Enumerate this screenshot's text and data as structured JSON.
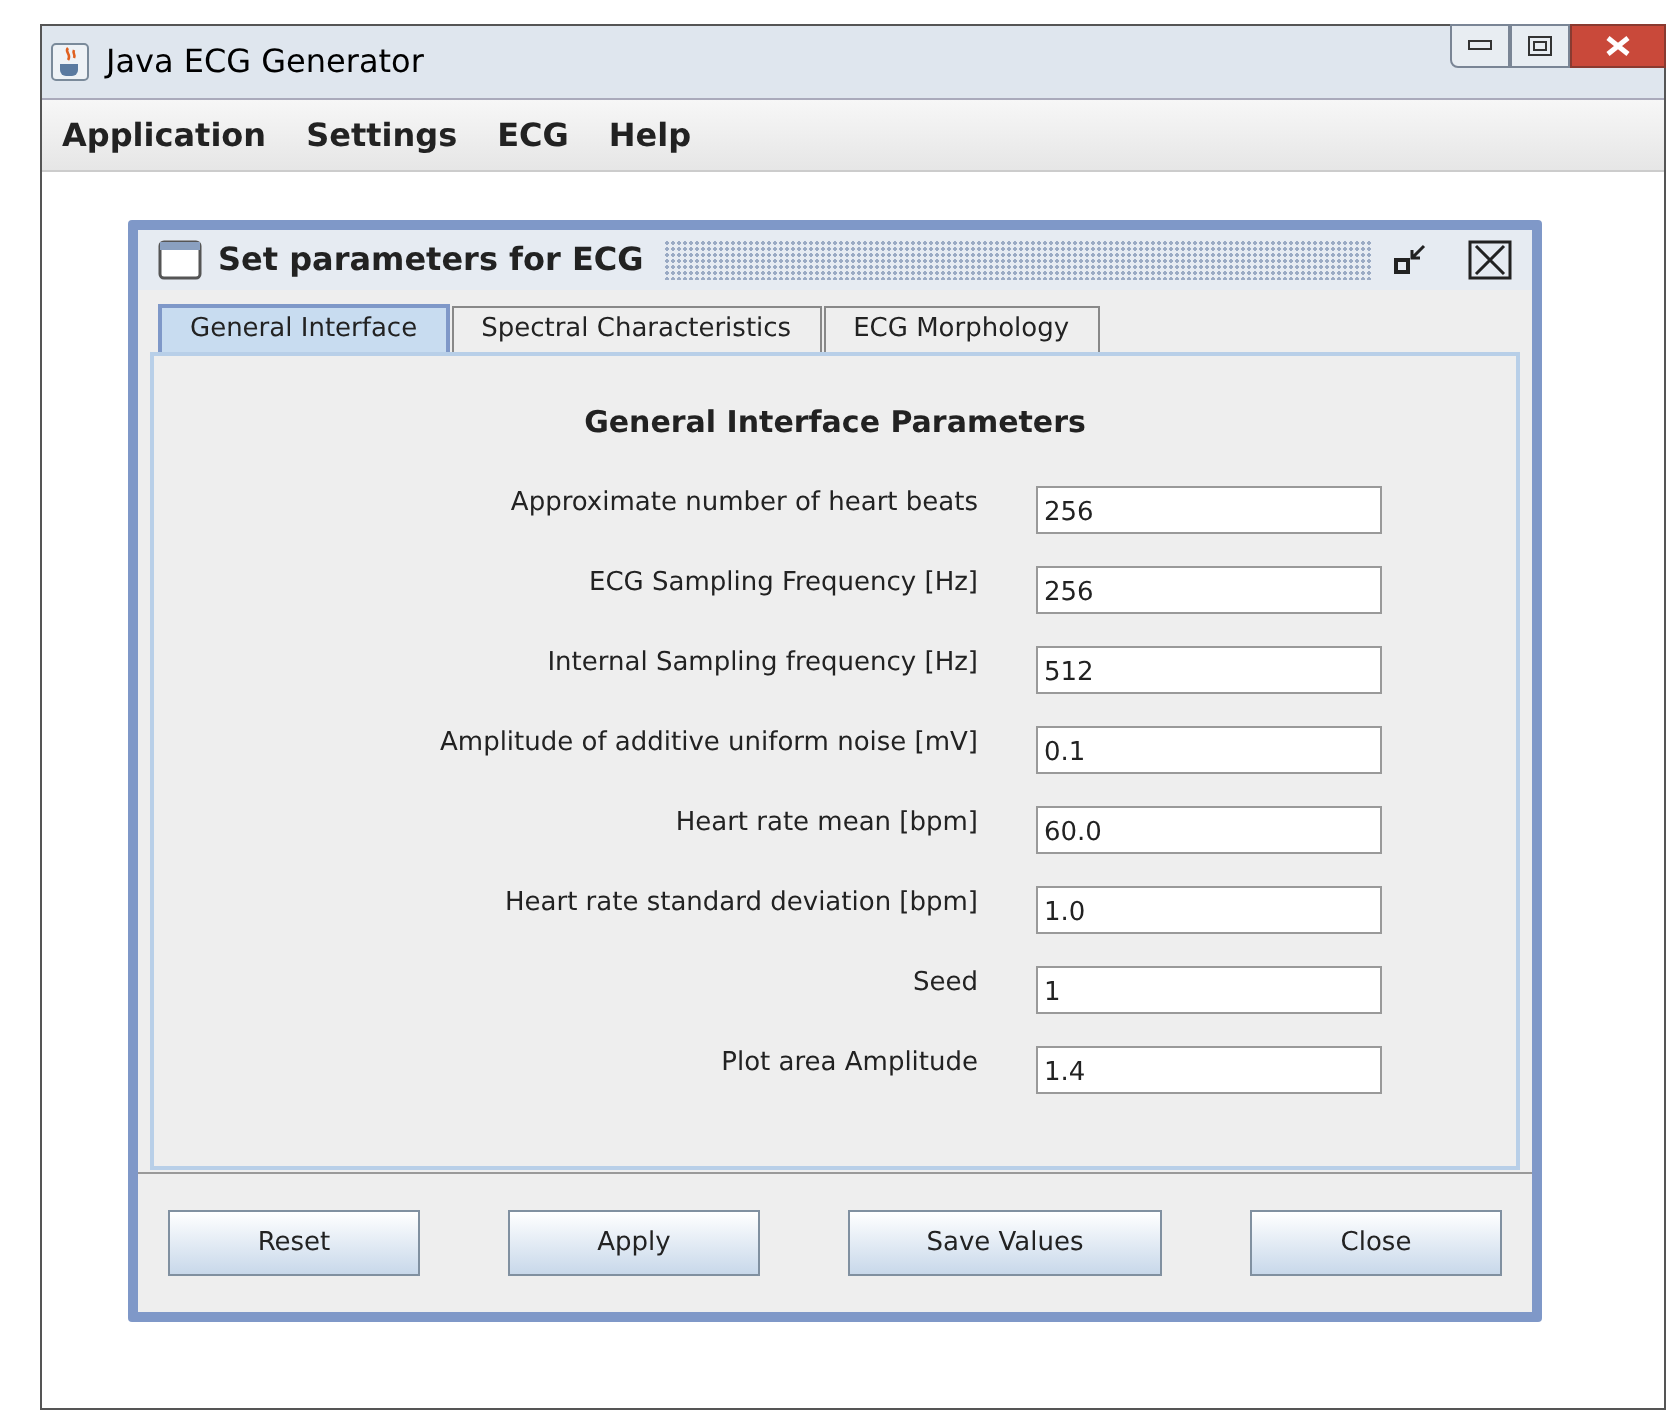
{
  "window": {
    "title": "Java ECG Generator"
  },
  "menu": [
    "Application",
    "Settings",
    "ECG",
    "Help"
  ],
  "dialog": {
    "title": "Set parameters for ECG",
    "tabs": [
      {
        "label": "General Interface",
        "selected": true
      },
      {
        "label": "Spectral Characteristics",
        "selected": false
      },
      {
        "label": "ECG Morphology",
        "selected": false
      }
    ],
    "heading": "General Interface Parameters",
    "fields": [
      {
        "label": "Approximate number of heart beats",
        "value": "256"
      },
      {
        "label": "ECG Sampling Frequency [Hz]",
        "value": "256"
      },
      {
        "label": "Internal Sampling frequency [Hz]",
        "value": "512"
      },
      {
        "label": "Amplitude of additive uniform noise [mV]",
        "value": "0.1"
      },
      {
        "label": "Heart rate mean [bpm]",
        "value": "60.0"
      },
      {
        "label": "Heart rate standard deviation [bpm]",
        "value": "1.0"
      },
      {
        "label": "Seed",
        "value": "1"
      },
      {
        "label": "Plot area Amplitude",
        "value": "1.4"
      }
    ],
    "buttons": [
      "Reset",
      "Apply",
      "Save Values",
      "Close"
    ]
  }
}
